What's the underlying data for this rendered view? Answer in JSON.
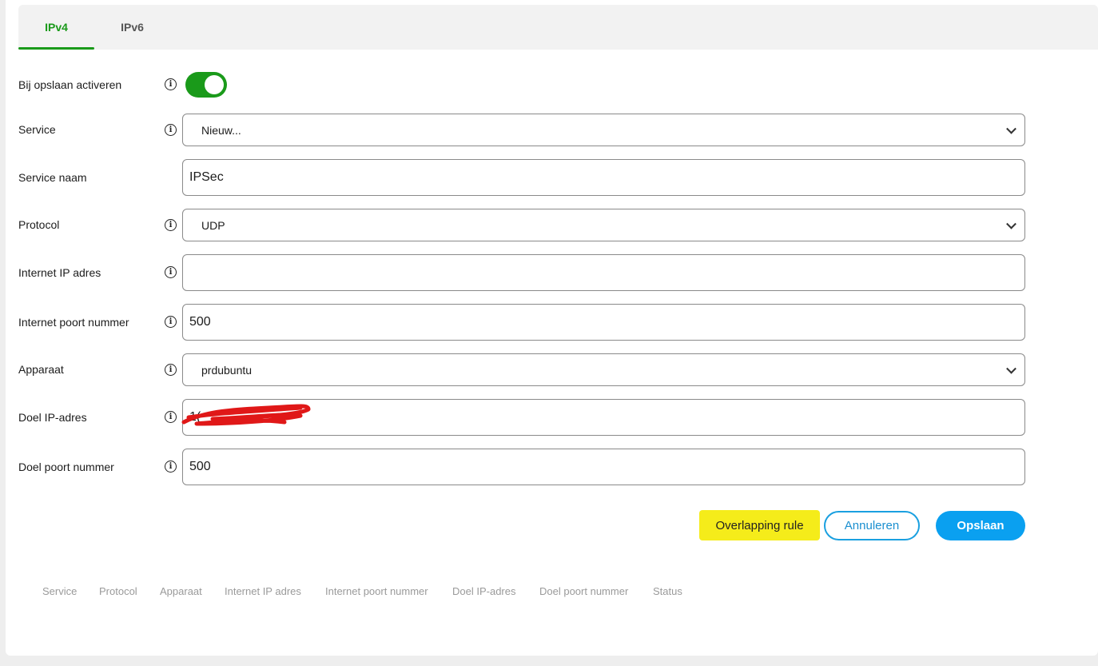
{
  "tabs": [
    {
      "label": "IPv4",
      "active": true
    },
    {
      "label": "IPv6",
      "active": false
    }
  ],
  "form": {
    "activate_label": "Bij opslaan activeren",
    "activate_on": true,
    "service_label": "Service",
    "service_value": "Nieuw...",
    "service_name_label": "Service naam",
    "service_name_value": "IPSec",
    "protocol_label": "Protocol",
    "protocol_value": "UDP",
    "internet_ip_label": "Internet IP adres",
    "internet_ip_value": "",
    "internet_port_label": "Internet poort nummer",
    "internet_port_value": "500",
    "device_label": "Apparaat",
    "device_value": "prdubuntu",
    "dest_ip_label": "Doel IP-adres",
    "dest_ip_value": "1(",
    "dest_port_label": "Doel poort nummer",
    "dest_port_value": "500"
  },
  "actions": {
    "warning": "Overlapping rule",
    "cancel": "Annuleren",
    "save": "Opslaan"
  },
  "table_headers": [
    "Service",
    "Protocol",
    "Apparaat",
    "Internet IP adres",
    "Internet poort nummer",
    "Doel IP-adres",
    "Doel poort nummer",
    "Status"
  ],
  "colors": {
    "accent_green": "#1a9a1a",
    "accent_blue": "#0aa0f0",
    "highlight_yellow": "#f5ec1a",
    "redaction_red": "#e01818"
  }
}
